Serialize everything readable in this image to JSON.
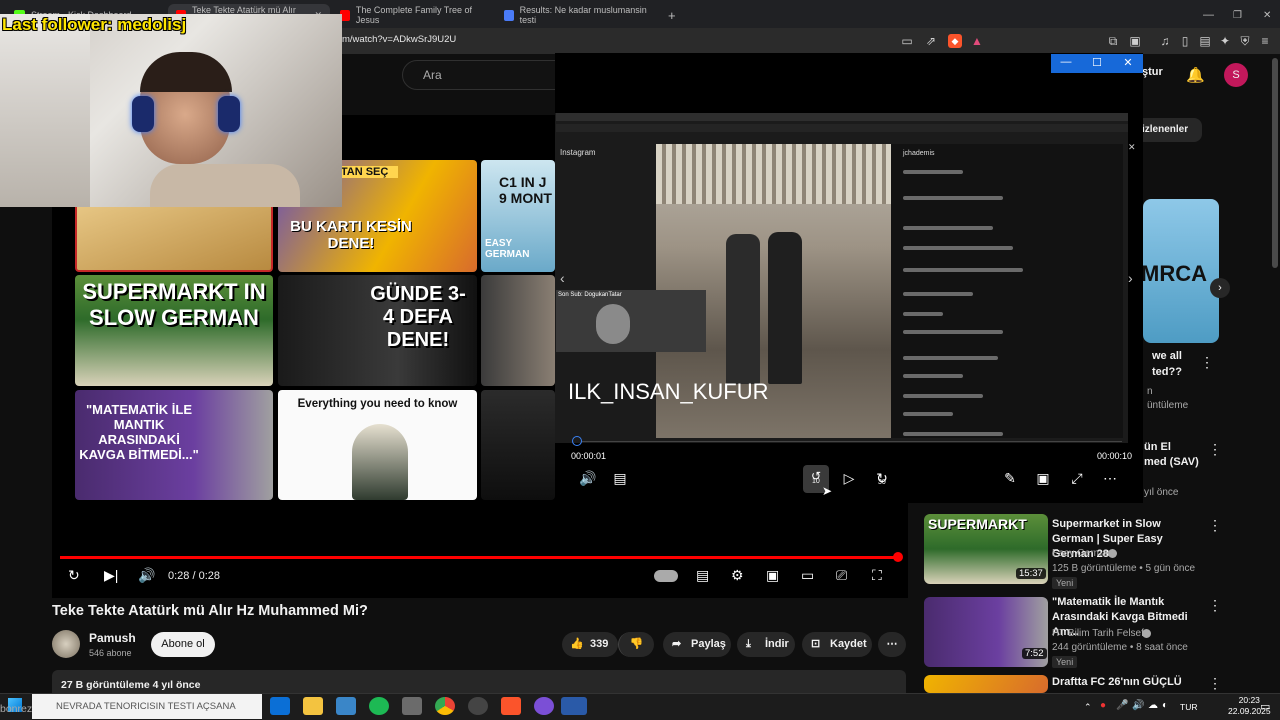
{
  "browser": {
    "tabs": [
      {
        "label": "Stream - Kick Dashboard",
        "color": "#53fc18"
      },
      {
        "label": "Teke Tekte Atatürk mü Alır Hz M",
        "color": "#ff0000"
      },
      {
        "label": "The Complete Family Tree of Jesus",
        "color": "#ff0000"
      },
      {
        "label": "Results: Ne kadar muslumansin testi",
        "color": "#4a7bf7"
      }
    ],
    "new_tab": "+",
    "url": "m/watch?v=ADkwSrJ9U2U"
  },
  "overlay": {
    "follower_text": "Last follower: medolisj"
  },
  "youtube": {
    "search_placeholder": "Ara",
    "header_right": {
      "create_label": "ştur",
      "avatar_letter": "S"
    },
    "chip_label": "izlenenler",
    "end_screen_thumbs": [
      {
        "caption": "KAPTAN SEÇ"
      },
      {
        "caption": "BU KARTI KESİN DENE!"
      },
      {
        "caption": "C1 IN J 9 MONT"
      },
      {
        "caption": "EASY GERMAN"
      },
      {
        "caption": "SUPERMARKT IN SLOW GERMAN"
      },
      {
        "caption": "GÜNDE 3-4 DEFA DENE!"
      },
      {
        "caption": "\"MATEMATİK İLE MANTIK ARASINDAKİ KAVGA BİTMEDİ...\""
      },
      {
        "caption": "Everything you need to know"
      }
    ],
    "player": {
      "time": "0:28 / 0:28",
      "progress": 1.0
    },
    "video": {
      "title": "Teke Tekte Atatürk mü Alır Hz Muhammed Mi?",
      "channel": "Pamush",
      "subs": "546 abone",
      "subscribe": "Abone ol",
      "likes": "339",
      "share": "Paylaş",
      "download": "İndir",
      "save": "Kaydet",
      "views_line": "27 B görüntüleme  4 yıl önce"
    },
    "sidebar": {
      "top_card_caption": "MRCA",
      "partial_title_1": "we all",
      "partial_title_2": "ted??",
      "partial_meta_1": "n",
      "partial_meta_2": "üntüleme",
      "partial_title_3": "ün El",
      "partial_title_4": "med (SAV)",
      "partial_meta_3": "yıl önce",
      "items": [
        {
          "title": "Supermarket in Slow German | Super Easy German 288",
          "channel": "Easy German",
          "meta": "125 B görüntüleme • 5 gün önce",
          "badge": "Yeni",
          "duration": "15:37"
        },
        {
          "title": "\"Matematik İle Mantık Arasındaki Kavga Bitmedi Am...",
          "channel": "HT Bilim Tarih Felsefe",
          "meta": "244 görüntüleme • 8 saat önce",
          "badge": "Yeni",
          "duration": "7:52"
        },
        {
          "title": "Draftta FC 26'nın GÜÇLÜ",
          "channel": "",
          "meta": "",
          "badge": "",
          "duration": ""
        }
      ]
    }
  },
  "popup_player": {
    "window_buttons": [
      "—",
      "☐",
      "✕"
    ],
    "overlay_title": "ILK_INSAN_KUFUR",
    "time_current": "00:00:01",
    "time_total": "00:00:10",
    "skip_back": "10",
    "skip_fwd": "30",
    "inner": {
      "app": "Instagram",
      "profile": "jchademis",
      "sub_label": "Son Sub: DogukanTatar"
    }
  },
  "taskbar": {
    "search_text": "NEVRADA TENORICISIN TESTI AÇSANA",
    "ticker": "bonrez",
    "lang": "TUR",
    "time": "20:23",
    "date": "22.09.2025"
  }
}
